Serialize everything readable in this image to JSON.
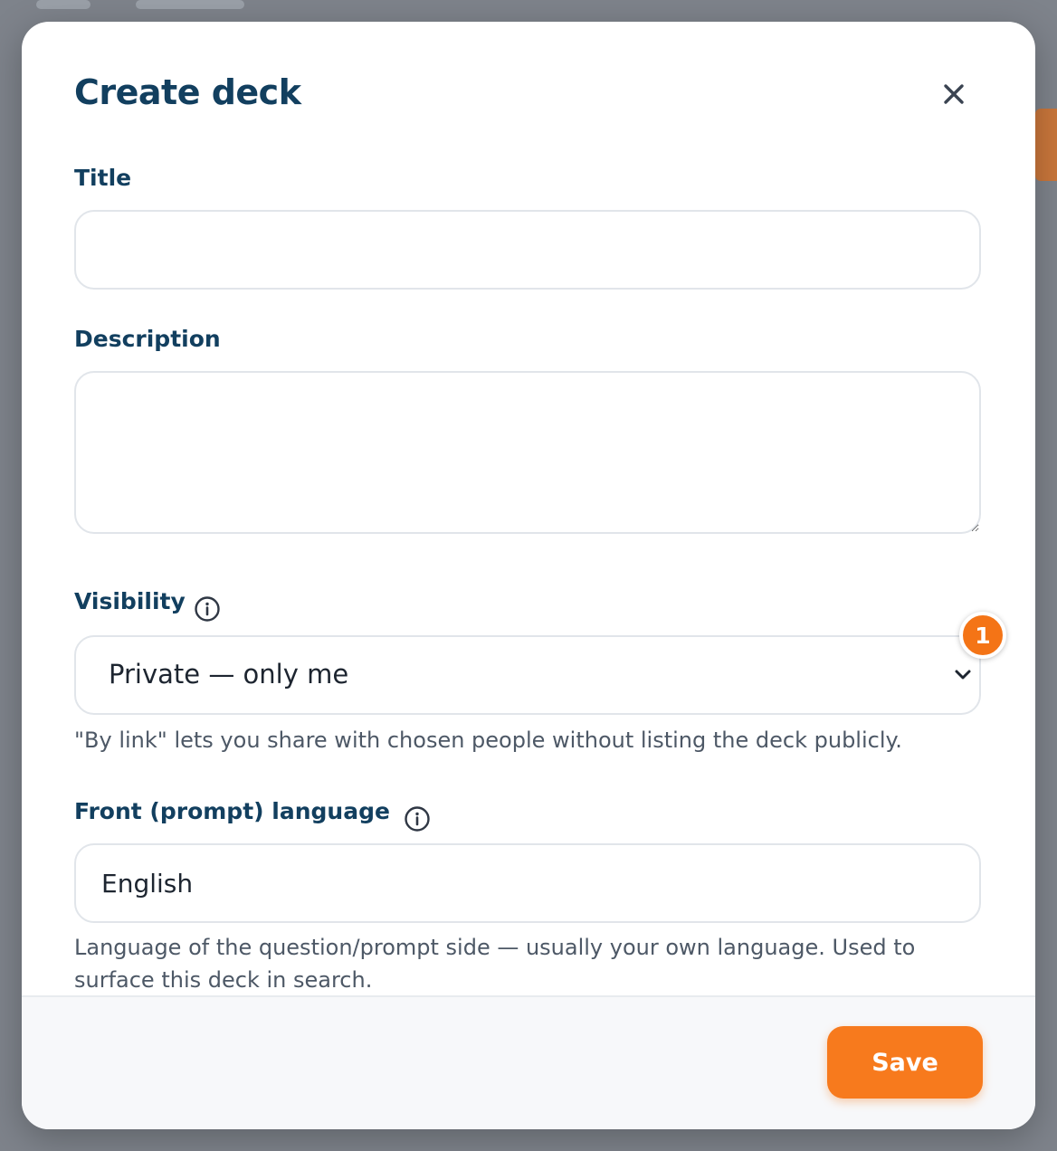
{
  "modal": {
    "title": "Create deck",
    "close_icon": "close-icon"
  },
  "form": {
    "title_label": "Title",
    "title_value": "",
    "description_label": "Description",
    "description_value": "",
    "visibility_label": "Visibility",
    "visibility_info_icon": "info-icon",
    "visibility_value": "Private — only me",
    "visibility_badge": "1",
    "visibility_help": "\"By link\" lets you share with chosen people without listing the deck publicly.",
    "front_language_label": "Front (prompt) language",
    "front_language_info_icon": "info-icon",
    "front_language_value": "English",
    "front_language_help": "Language of the question/prompt side — usually your own language. Used to surface this deck in search."
  },
  "footer": {
    "save_label": "Save"
  },
  "colors": {
    "heading": "#123f5f",
    "accent": "#f77a1d",
    "border": "#e1e5ea",
    "overlay": "#7e838b"
  }
}
